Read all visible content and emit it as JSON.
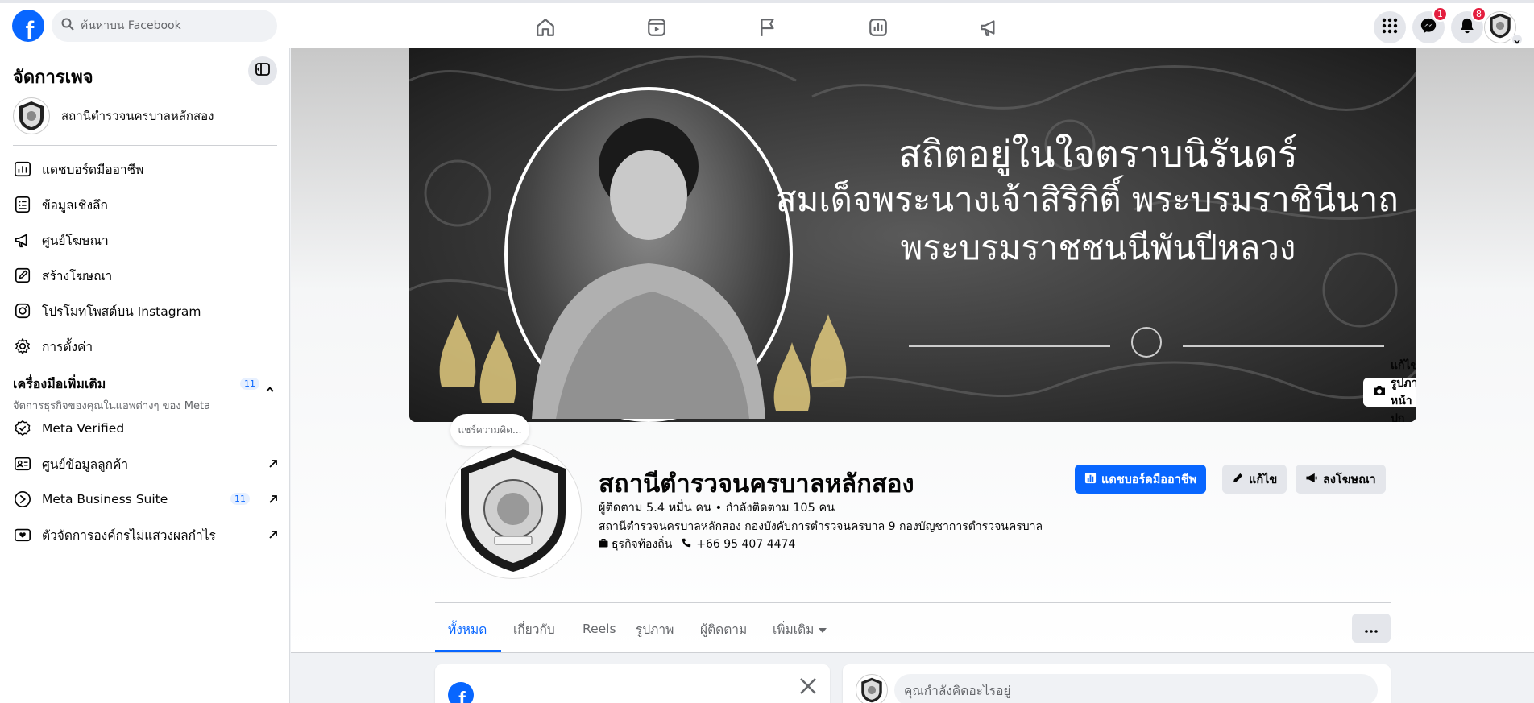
{
  "topbar": {
    "logo_letter": "f",
    "search_placeholder": "ค้นหาบน Facebook",
    "messenger_badge": "1",
    "notifications_badge": "8"
  },
  "sidebar": {
    "title": "จัดการเพจ",
    "page_name": "สถานีตำรวจนครบาลหลักสอง",
    "items": [
      {
        "label": "แดชบอร์ดมืออาชีพ",
        "icon": "dashboard-icon"
      },
      {
        "label": "ข้อมูลเชิงลึก",
        "icon": "insights-icon"
      },
      {
        "label": "ศูนย์โฆษณา",
        "icon": "megaphone-icon"
      },
      {
        "label": "สร้างโฆษณา",
        "icon": "pencil-icon"
      },
      {
        "label": "โปรโมทโพสต์บน Instagram",
        "icon": "instagram-icon"
      },
      {
        "label": "การตั้งค่า",
        "icon": "gear-icon"
      }
    ],
    "tools_header": "เครื่องมือเพิ่มเติม",
    "tools_count": "11",
    "tools_subtitle": "จัดการธุรกิจของคุณในแอพต่างๆ ของ Meta",
    "tools": [
      {
        "label": "Meta Verified",
        "icon": "verified-icon"
      },
      {
        "label": "ศูนย์ข้อมูลลูกค้า",
        "icon": "contact-card-icon"
      },
      {
        "label": "Meta Business Suite",
        "icon": "business-suite-icon",
        "count": "11"
      },
      {
        "label": "ตัวจัดการองค์กรไม่แสวงผลกำไร",
        "icon": "nonprofit-icon"
      }
    ]
  },
  "cover": {
    "line1": "สถิตอยู่ในใจตราบนิรันดร์",
    "line2": "สมเด็จพระนางเจ้าสิริกิติ์ พระบรมราชินีนาถ",
    "line3": "พระบรมราชชนนีพันปีหลวง",
    "edit_label": "แก้ไขรูปภาพหน้าปก"
  },
  "profile": {
    "note": "แชร์ความคิด...",
    "name": "สถานีตำรวจนครบาลหลักสอง",
    "stats": "ผู้ติดตาม 5.4 หมื่น คน • กำลังติดตาม 105 คน",
    "description": "สถานีตำรวจนครบาลหลักสอง กองบังคับการตำรวจนครบาล 9 กองบัญชาการตำรวจนครบาล",
    "category": "ธุรกิจท้องถิ่น",
    "phone": "+66 95 407 4474",
    "btn_dashboard": "แดชบอร์ดมืออาชีพ",
    "btn_edit": "แก้ไข",
    "btn_advertise": "ลงโฆษณา"
  },
  "tabs": [
    "ทั้งหมด",
    "เกี่ยวกับ",
    "Reels",
    "รูปภาพ",
    "ผู้ติดตาม",
    "เพิ่มเติม"
  ],
  "composer": {
    "placeholder": "คุณกำลังคิดอะไรอยู่"
  },
  "colors": {
    "accent": "#0866ff",
    "badge": "#e41e3f"
  }
}
